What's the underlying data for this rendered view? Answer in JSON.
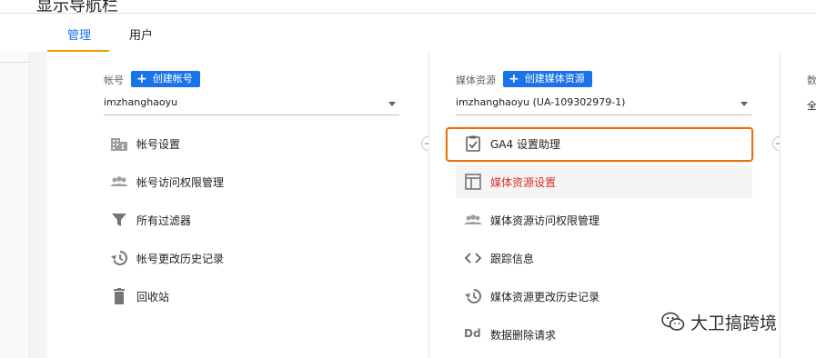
{
  "header": {
    "title": "显示导航栏"
  },
  "tabs": [
    {
      "label": "管理",
      "active": true
    },
    {
      "label": "用户",
      "active": false
    }
  ],
  "account": {
    "heading": "帐号",
    "create_label": "创建帐号",
    "selected": "imzhanghaoyu",
    "items": [
      {
        "label": "帐号设置",
        "icon": "building-icon"
      },
      {
        "label": "帐号访问权限管理",
        "icon": "people-icon"
      },
      {
        "label": "所有过滤器",
        "icon": "filter-icon"
      },
      {
        "label": "帐号更改历史记录",
        "icon": "history-icon"
      },
      {
        "label": "回收站",
        "icon": "trash-icon"
      }
    ]
  },
  "property": {
    "heading": "媒体资源",
    "create_label": "创建媒体资源",
    "selected": "imzhanghaoyu (UA-109302979-1)",
    "items": [
      {
        "label": "GA4 设置助理",
        "icon": "clipboard-check-icon",
        "highlighted": true
      },
      {
        "label": "媒体资源设置",
        "icon": "layout-icon",
        "selected": true
      },
      {
        "label": "媒体资源访问权限管理",
        "icon": "people-icon"
      },
      {
        "label": "跟踪信息",
        "icon": "code-icon"
      },
      {
        "label": "媒体资源更改历史记录",
        "icon": "history-icon"
      },
      {
        "label": "数据删除请求",
        "icon": "dd-icon",
        "icon_text": "Dd"
      }
    ]
  },
  "view": {
    "heading_partial": "数",
    "value_partial": "全"
  },
  "watermark": {
    "text": "大卫搞跨境"
  },
  "colors": {
    "accent": "#1a73e8",
    "tab_underline": "#f29900",
    "highlight": "#e8710a",
    "selected_text": "#d93025"
  }
}
